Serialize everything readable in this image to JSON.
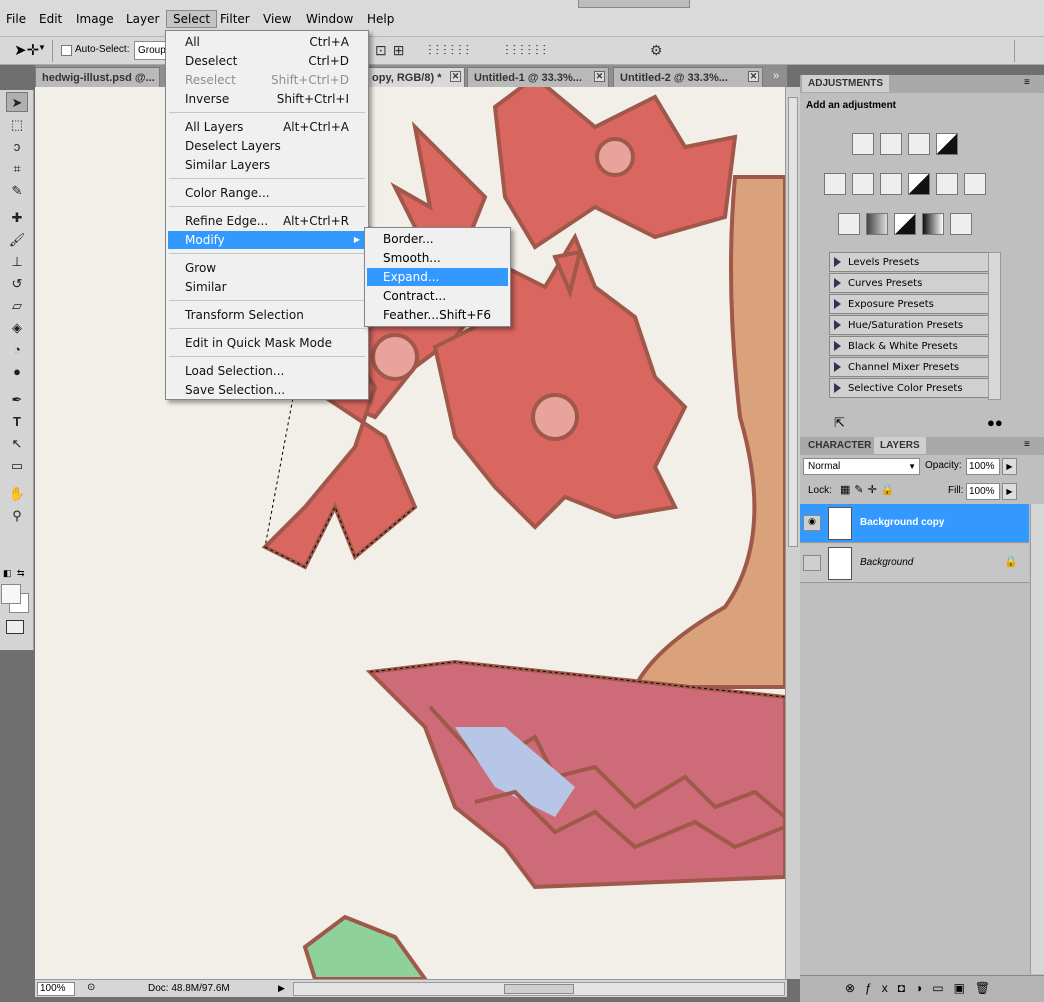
{
  "menubar": {
    "items": [
      "File",
      "Edit",
      "Image",
      "Layer",
      "Select",
      "Filter",
      "View",
      "Window",
      "Help"
    ]
  },
  "options": {
    "auto_select_label": "Auto-Select:",
    "auto_select_value": "Group"
  },
  "tabs": [
    {
      "label": "hedwig-illust.psd @..."
    },
    {
      "label": "opy, RGB/8) *"
    },
    {
      "label": "Untitled-1 @ 33.3%..."
    },
    {
      "label": "Untitled-2 @ 33.3%..."
    }
  ],
  "select_menu": {
    "items": [
      {
        "label": "All",
        "shortcut": "Ctrl+A",
        "disabled": false
      },
      {
        "label": "Deselect",
        "shortcut": "Ctrl+D",
        "disabled": false
      },
      {
        "label": "Reselect",
        "shortcut": "Shift+Ctrl+D",
        "disabled": true
      },
      {
        "label": "Inverse",
        "shortcut": "Shift+Ctrl+I",
        "disabled": false
      },
      {
        "label": "All Layers",
        "shortcut": "Alt+Ctrl+A",
        "disabled": false
      },
      {
        "label": "Deselect Layers",
        "shortcut": "",
        "disabled": false
      },
      {
        "label": "Similar Layers",
        "shortcut": "",
        "disabled": false
      },
      {
        "label": "Color Range...",
        "shortcut": "",
        "disabled": false
      },
      {
        "label": "Refine Edge...",
        "shortcut": "Alt+Ctrl+R",
        "disabled": false
      },
      {
        "label": "Modify",
        "shortcut": "",
        "disabled": false
      },
      {
        "label": "Grow",
        "shortcut": "",
        "disabled": false
      },
      {
        "label": "Similar",
        "shortcut": "",
        "disabled": false
      },
      {
        "label": "Transform Selection",
        "shortcut": "",
        "disabled": false
      },
      {
        "label": "Edit in Quick Mask Mode",
        "shortcut": "",
        "disabled": false
      },
      {
        "label": "Load Selection...",
        "shortcut": "",
        "disabled": false
      },
      {
        "label": "Save Selection...",
        "shortcut": "",
        "disabled": false
      }
    ]
  },
  "modify_submenu": {
    "items": [
      {
        "label": "Border...",
        "shortcut": ""
      },
      {
        "label": "Smooth...",
        "shortcut": ""
      },
      {
        "label": "Expand...",
        "shortcut": ""
      },
      {
        "label": "Contract...",
        "shortcut": ""
      },
      {
        "label": "Feather...",
        "shortcut": "Shift+F6"
      }
    ]
  },
  "adjustments": {
    "tab_label": "ADJUSTMENTS",
    "heading": "Add an adjustment",
    "presets": [
      "Levels Presets",
      "Curves Presets",
      "Exposure Presets",
      "Hue/Saturation Presets",
      "Black & White Presets",
      "Channel Mixer Presets",
      "Selective Color Presets"
    ]
  },
  "layers_panel": {
    "tab_character": "CHARACTER",
    "tab_layers": "LAYERS",
    "blend_mode": "Normal",
    "opacity_label": "Opacity:",
    "opacity_value": "100%",
    "lock_label": "Lock:",
    "fill_label": "Fill:",
    "fill_value": "100%",
    "layers": [
      {
        "name": "Background copy",
        "selected": true,
        "visible": true
      },
      {
        "name": "Background",
        "selected": false,
        "visible": false
      }
    ]
  },
  "status": {
    "zoom": "100%",
    "doc": "Doc: 48.8M/97.6M"
  },
  "colors": {
    "highlight": "#3399ff",
    "menu_bg": "#f0f0f0",
    "canvas_paper": "#f2efe9",
    "flower_red": "#d9665f",
    "outline": "#a0584a"
  }
}
